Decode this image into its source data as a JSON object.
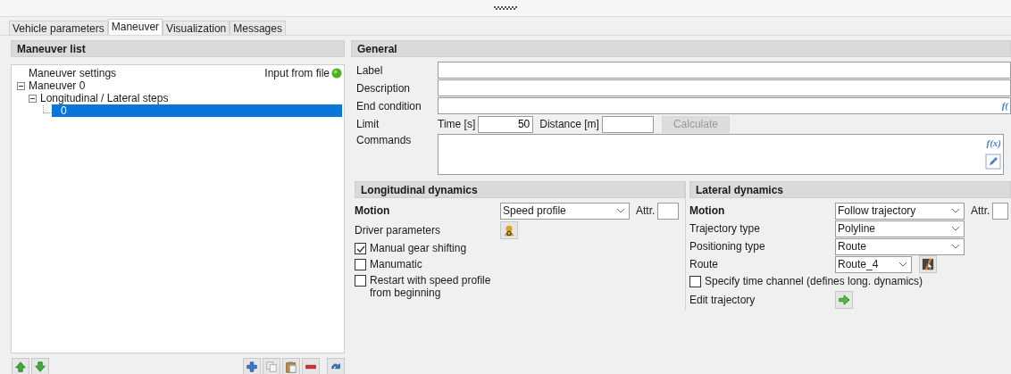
{
  "tabs": [
    {
      "label": "Vehicle parameters",
      "selected": false
    },
    {
      "label": "Maneuver",
      "selected": true
    },
    {
      "label": "Visualization",
      "selected": false
    },
    {
      "label": "Messages",
      "selected": false
    }
  ],
  "maneuver_list": {
    "title": "Maneuver list",
    "tree": [
      {
        "label": "Maneuver settings",
        "note": "Input from file",
        "selected": false
      },
      {
        "label": "Maneuver  0",
        "expanded": true,
        "selected": false,
        "children": [
          {
            "label": "Longitudinal / Lateral steps",
            "expanded": true,
            "selected": false,
            "children": [
              {
                "label": "0",
                "selected": true
              }
            ]
          }
        ]
      }
    ]
  },
  "general": {
    "title": "General",
    "fields": [
      {
        "label": "Label"
      },
      {
        "label": "Description"
      },
      {
        "label": "End condition",
        "formula_label": "f("
      }
    ],
    "limit": {
      "label": "Limit",
      "time_label": "Time [s]",
      "time_value": "50",
      "distance_label": "Distance [m]",
      "button": "Calculate",
      "button_disabled": true
    },
    "commands": {
      "label": "Commands",
      "formula_label": "f(x)"
    }
  },
  "longitudinal_dynamics": {
    "title": "Longitudinal dynamics",
    "rows": [
      {
        "kind": "select",
        "label": "Motion",
        "value": "Speed profile",
        "attr_label": "Attr."
      },
      {
        "kind": "button",
        "label": "Driver parameters"
      },
      {
        "kind": "checkbox",
        "label": "Manual gear shifting",
        "checked": true
      },
      {
        "kind": "checkbox",
        "label": "Manumatic",
        "checked": false
      },
      {
        "kind": "checkbox",
        "label": "Restart with speed profile from beginning",
        "checked": false
      }
    ]
  },
  "lateral_dynamics": {
    "title": "Lateral dynamics",
    "rows": [
      {
        "kind": "select",
        "label": "Motion",
        "value": "Follow trajectory",
        "attr_label": "Attr."
      },
      {
        "kind": "select",
        "label": "Trajectory type",
        "value": "Polyline"
      },
      {
        "kind": "select",
        "label": "Positioning type",
        "value": "Route"
      },
      {
        "kind": "select",
        "label": "Route",
        "value": "Route_4"
      },
      {
        "kind": "checkbox",
        "label": "Specify time channel (defines long. dynamics)",
        "checked": false
      },
      {
        "kind": "button",
        "label": "Edit trajectory"
      }
    ]
  }
}
